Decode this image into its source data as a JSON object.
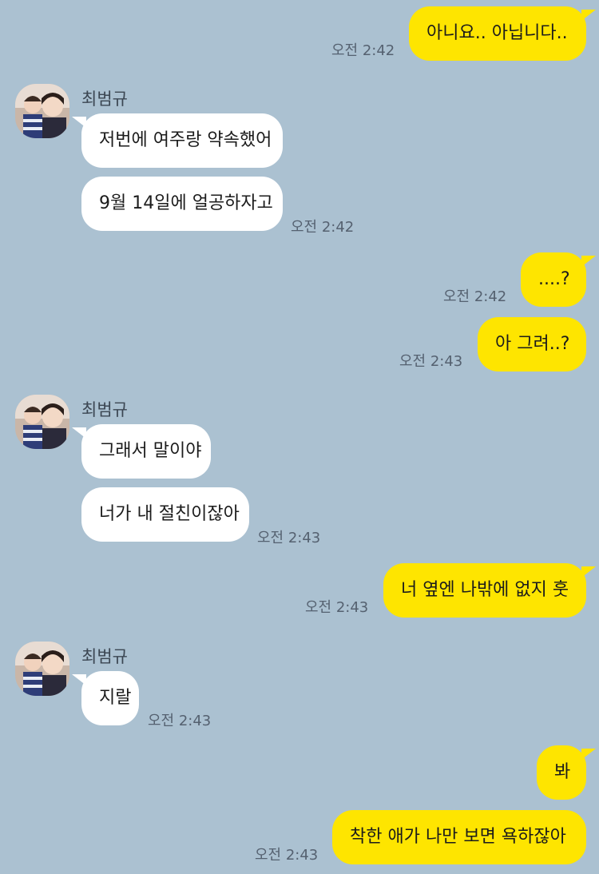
{
  "chat": {
    "sender_name": "최범규",
    "messages": [
      {
        "from": "me",
        "text": "아니요.. 아닙니다..",
        "time": "오전 2:42"
      },
      {
        "from": "them",
        "text": "저번에 여주랑 약속했어"
      },
      {
        "from": "them",
        "text": "9월 14일에 얼공하자고",
        "time": "오전 2:42"
      },
      {
        "from": "me",
        "text": "....?",
        "time": "오전 2:42"
      },
      {
        "from": "me",
        "text": "아 그려..?",
        "time": "오전 2:43"
      },
      {
        "from": "them",
        "text": "그래서 말이야"
      },
      {
        "from": "them",
        "text": "너가 내 절친이잖아",
        "time": "오전 2:43"
      },
      {
        "from": "me",
        "text": "너 옆엔 나밖에 없지 훗",
        "time": "오전 2:43"
      },
      {
        "from": "them",
        "text": "지랄",
        "time": "오전 2:43"
      },
      {
        "from": "me",
        "text": "봐"
      },
      {
        "from": "me",
        "text": "착한 애가 나만 보면 욕하잖아",
        "time": "오전 2:43"
      }
    ]
  },
  "colors": {
    "background": "#abc1d1",
    "my_bubble": "#fee500",
    "their_bubble": "#ffffff"
  },
  "icons": {
    "avatar": "profile-photo"
  }
}
